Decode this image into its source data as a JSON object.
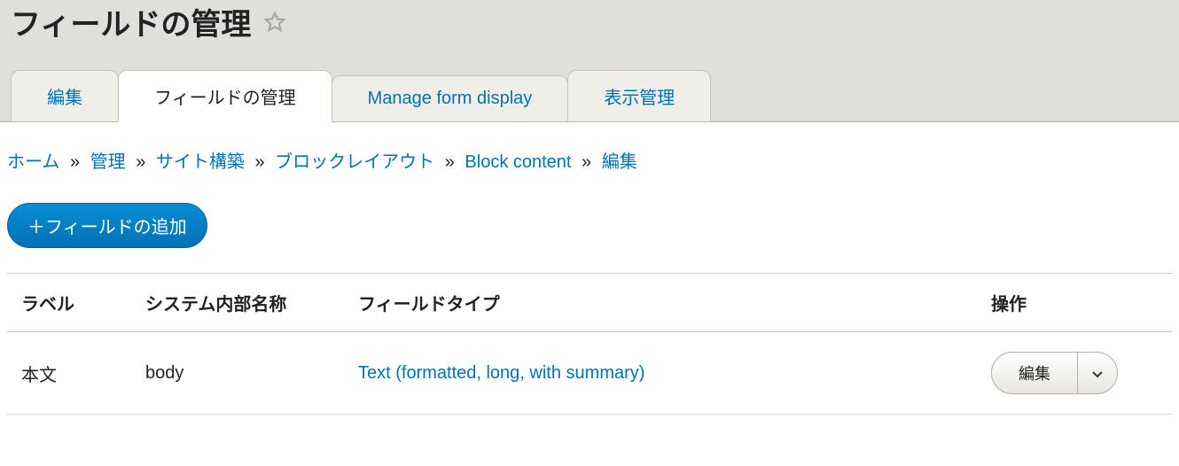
{
  "page": {
    "title": "フィールドの管理"
  },
  "tabs": [
    {
      "label": "編集",
      "active": false
    },
    {
      "label": "フィールドの管理",
      "active": true
    },
    {
      "label": "Manage form display",
      "active": false
    },
    {
      "label": "表示管理",
      "active": false
    }
  ],
  "breadcrumb": {
    "items": [
      "ホーム",
      "管理",
      "サイト構築",
      "ブロックレイアウト",
      "Block content",
      "編集"
    ],
    "separator": "»"
  },
  "actions": {
    "add_field": "＋フィールドの追加"
  },
  "table": {
    "headers": {
      "label": "ラベル",
      "machine_name": "システム内部名称",
      "field_type": "フィールドタイプ",
      "operations": "操作"
    },
    "rows": [
      {
        "label": "本文",
        "machine_name": "body",
        "field_type": "Text (formatted, long, with summary)",
        "op_label": "編集"
      }
    ]
  }
}
